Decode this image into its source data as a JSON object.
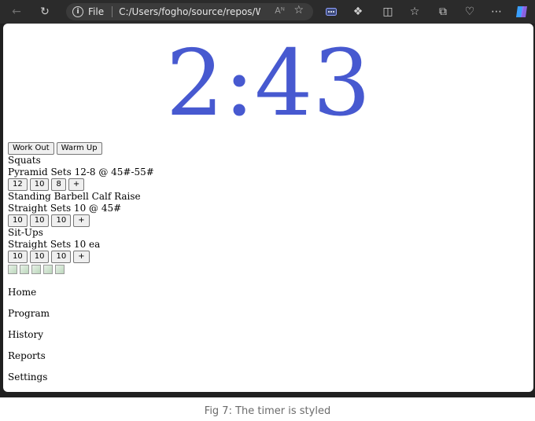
{
  "browser": {
    "file_label": "File",
    "url": "C:/Users/fogho/source/repos/Work...",
    "read_aloud": "Aᴺ",
    "icons": [
      "back-icon",
      "refresh-icon",
      "info-icon",
      "favorite-star-icon",
      "extensions-icon",
      "puzzle-icon",
      "split-screen-icon",
      "favorites-icon",
      "collections-icon",
      "health-icon",
      "more-icon",
      "copilot-icon"
    ]
  },
  "timer": {
    "value": "2:43",
    "color": "#4759d0"
  },
  "mode_buttons": {
    "workout": "Work Out",
    "warmup": "Warm Up"
  },
  "exercises": [
    {
      "name": "Squats",
      "scheme": "Pyramid Sets 12-8 @ 45#-55#",
      "sets": [
        "12",
        "10",
        "8"
      ]
    },
    {
      "name": "Standing Barbell Calf Raise",
      "scheme": "Straight Sets 10 @ 45#",
      "sets": [
        "10",
        "10",
        "10"
      ]
    },
    {
      "name": "Sit-Ups",
      "scheme": "Straight Sets 10 ea",
      "sets": [
        "10",
        "10",
        "10"
      ]
    }
  ],
  "add_set_label": "+",
  "nav": {
    "home": "Home",
    "program": "Program",
    "history": "History",
    "reports": "Reports",
    "settings": "Settings"
  },
  "caption": "Fig 7: The timer is styled"
}
